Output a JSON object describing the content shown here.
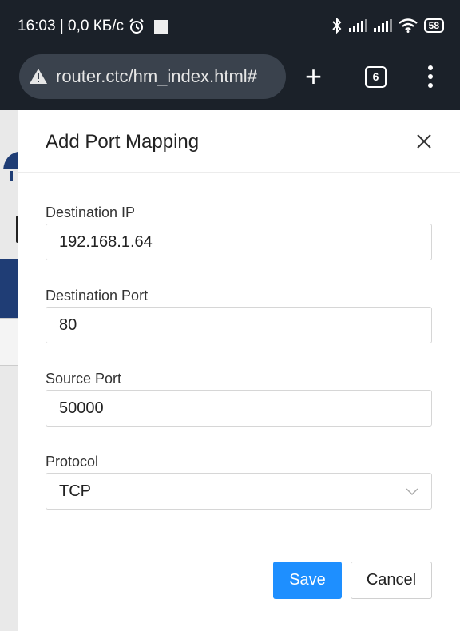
{
  "status_bar": {
    "time_and_speed": "16:03 | 0,0 КБ/с",
    "battery": "58",
    "icons": [
      "alarm-icon",
      "bluetooth-icon",
      "signal-icon",
      "signal-icon",
      "wifi-icon",
      "battery-icon"
    ]
  },
  "browser": {
    "url": "router.ctc/hm_index.html#",
    "tab_count": "6",
    "icons": [
      "warning-icon",
      "new-tab-icon",
      "tabs-icon",
      "menu-icon"
    ]
  },
  "modal": {
    "title": "Add Port Mapping",
    "fields": {
      "destination_ip": {
        "label": "Destination IP",
        "value": "192.168.1.64"
      },
      "destination_port": {
        "label": "Destination Port",
        "value": "80"
      },
      "source_port": {
        "label": "Source Port",
        "value": "50000"
      },
      "protocol": {
        "label": "Protocol",
        "value": "TCP"
      }
    },
    "buttons": {
      "save": "Save",
      "cancel": "Cancel"
    }
  },
  "colors": {
    "primary": "#1e8fff",
    "status_bar": "#1b2129",
    "url_pill": "#3a424d"
  }
}
